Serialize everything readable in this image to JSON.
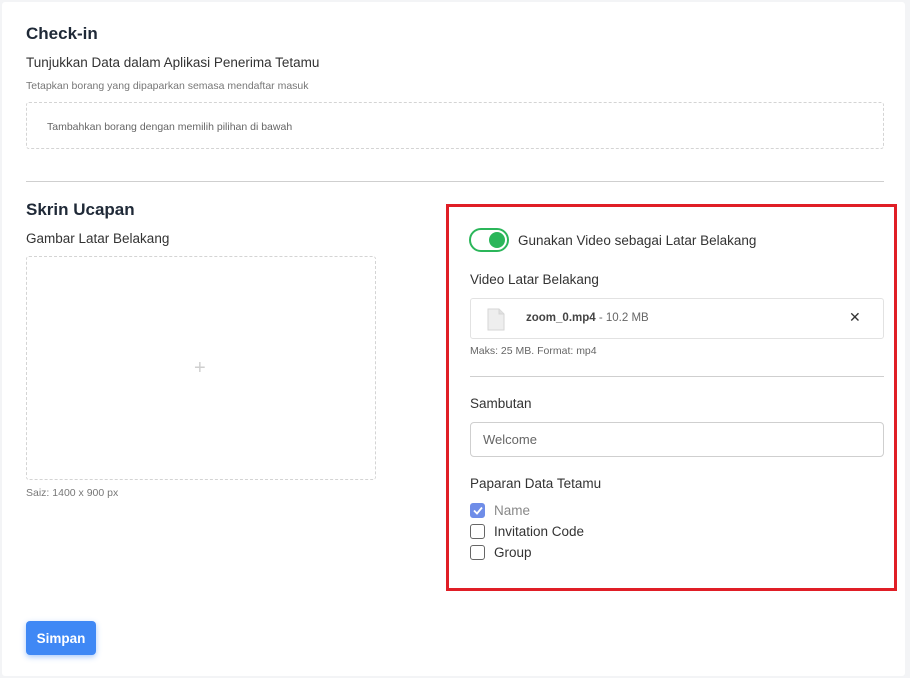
{
  "checkin": {
    "title": "Check-in",
    "subtitle": "Tunjukkan Data dalam Aplikasi Penerima Tetamu",
    "hint": "Tetapkan borang yang dipaparkan semasa mendaftar masuk",
    "placeholder_box": "Tambahkan borang dengan memilih pilihan di bawah"
  },
  "welcome_screen": {
    "title": "Skrin Ucapan",
    "bg_image_label": "Gambar Latar Belakang",
    "bg_image_plus": "+",
    "bg_image_size": "Saiz: 1400 x 900 px"
  },
  "video_panel": {
    "toggle_label": "Gunakan Video sebagai Latar Belakang",
    "toggle_on": true,
    "video_label": "Video Latar Belakang",
    "file_name": "zoom_0.mp4",
    "file_size": " - 10.2 MB",
    "remove_symbol": "✕",
    "file_hint": "Maks: 25 MB. Format: mp4",
    "greeting_label": "Sambutan",
    "greeting_placeholder": "Welcome",
    "guest_data_label": "Paparan Data Tetamu",
    "options": [
      {
        "label": "Name",
        "checked": true
      },
      {
        "label": "Invitation Code",
        "checked": false
      },
      {
        "label": "Group",
        "checked": false
      }
    ]
  },
  "actions": {
    "save_label": "Simpan"
  },
  "colors": {
    "accent_green": "#2bb65a",
    "highlight_red": "#e01e26",
    "button_blue": "#3f88f5",
    "checkbox_blue": "#6f8de8"
  }
}
